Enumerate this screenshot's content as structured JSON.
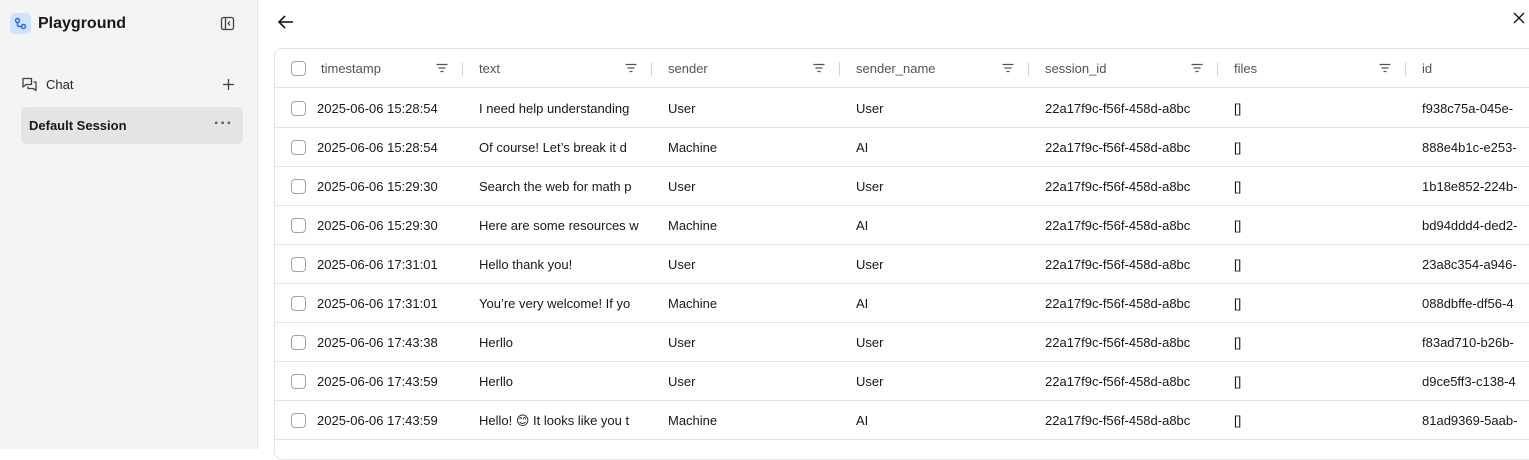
{
  "sidebar": {
    "app_title": "Playground",
    "section_label": "Chat",
    "session_label": "Default Session",
    "session_more": "···"
  },
  "table": {
    "columns": [
      "timestamp",
      "text",
      "sender",
      "sender_name",
      "session_id",
      "files",
      "id"
    ],
    "rows": [
      [
        "2025-06-06 15:28:54",
        "I need help understanding",
        "User",
        "User",
        "22a17f9c-f56f-458d-a8bc",
        "[]",
        "f938c75a-045e-"
      ],
      [
        "2025-06-06 15:28:54",
        "Of course! Let’s break it d",
        "Machine",
        "AI",
        "22a17f9c-f56f-458d-a8bc",
        "[]",
        "888e4b1c-e253-"
      ],
      [
        "2025-06-06 15:29:30",
        "Search the web for math p",
        "User",
        "User",
        "22a17f9c-f56f-458d-a8bc",
        "[]",
        "1b18e852-224b-"
      ],
      [
        "2025-06-06 15:29:30",
        "Here are some resources w",
        "Machine",
        "AI",
        "22a17f9c-f56f-458d-a8bc",
        "[]",
        "bd94ddd4-ded2-"
      ],
      [
        "2025-06-06 17:31:01",
        "Hello thank you!",
        "User",
        "User",
        "22a17f9c-f56f-458d-a8bc",
        "[]",
        "23a8c354-a946-"
      ],
      [
        "2025-06-06 17:31:01",
        "You’re very welcome! If yo",
        "Machine",
        "AI",
        "22a17f9c-f56f-458d-a8bc",
        "[]",
        "088dbffe-df56-4"
      ],
      [
        "2025-06-06 17:43:38",
        "Herllo",
        "User",
        "User",
        "22a17f9c-f56f-458d-a8bc",
        "[]",
        "f83ad710-b26b-"
      ],
      [
        "2025-06-06 17:43:59",
        "Herllo",
        "User",
        "User",
        "22a17f9c-f56f-458d-a8bc",
        "[]",
        "d9ce5ff3-c138-4"
      ],
      [
        "2025-06-06 17:43:59",
        "Hello! 😊 It looks like you t",
        "Machine",
        "AI",
        "22a17f9c-f56f-458d-a8bc",
        "[]",
        "81ad9369-5aab-"
      ]
    ]
  },
  "colors": {
    "sidebar_bg": "#f4f4f5",
    "session_active_bg": "#e4e4e7",
    "border": "#e4e4e7",
    "logo_bg": "#cfe2ff",
    "logo_fg": "#2563eb"
  },
  "icons": {
    "logo": "playground-logo-icon",
    "collapse": "sidebar-collapse-icon",
    "chat": "chat-bubbles-icon",
    "add": "plus-icon",
    "back": "arrow-left-icon",
    "close": "close-icon",
    "filter": "filter-icon"
  }
}
